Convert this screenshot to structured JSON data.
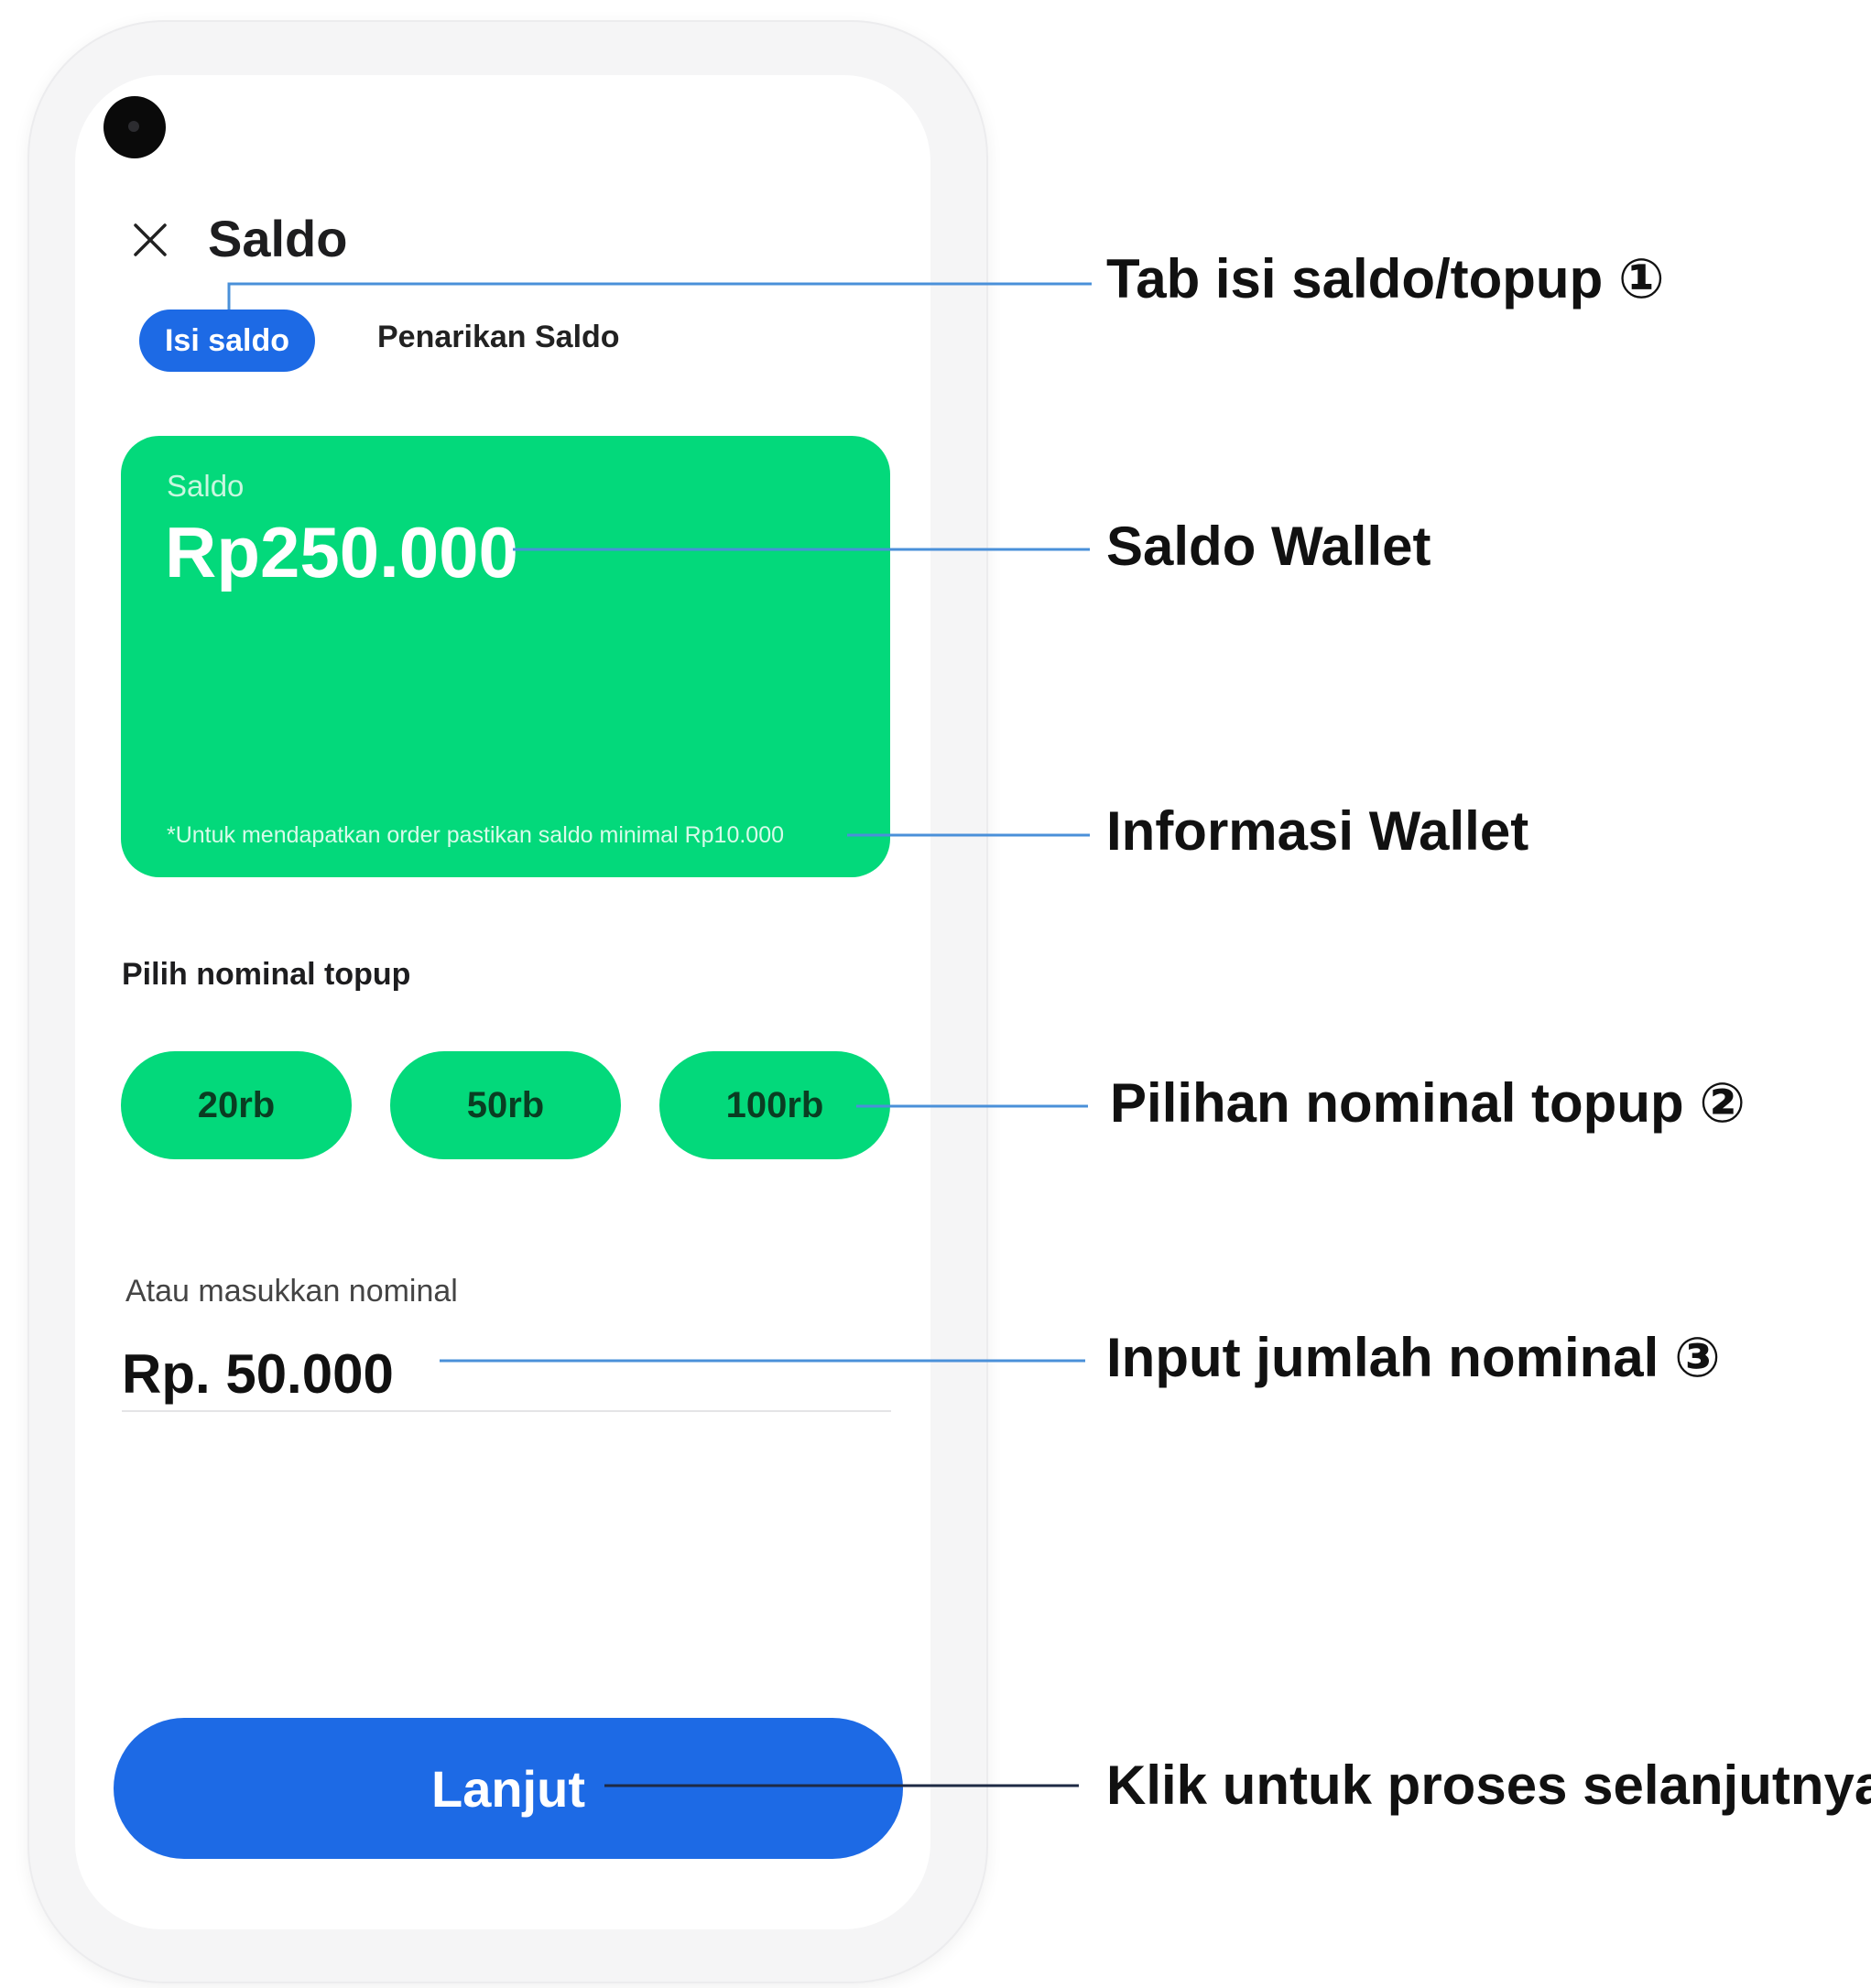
{
  "header": {
    "title": "Saldo",
    "close_icon": "close-icon"
  },
  "tabs": [
    {
      "label": "Isi saldo",
      "active": true
    },
    {
      "label": "Penarikan Saldo",
      "active": false
    }
  ],
  "wallet": {
    "label": "Saldo",
    "amount": "Rp250.000",
    "info": "*Untuk mendapatkan order pastikan saldo minimal Rp10.000"
  },
  "topup": {
    "section_label": "Pilih nominal topup",
    "options": [
      "20rb",
      "50rb",
      "100rb"
    ]
  },
  "amount_input": {
    "label": "Atau masukkan nominal",
    "value": "Rp. 50.000"
  },
  "next_button": {
    "label": "Lanjut"
  },
  "callouts": {
    "tab": "Tab isi saldo/topup ①",
    "wallet": "Saldo Wallet",
    "info": "Informasi Wallet",
    "options": "Pilihan nominal topup ②",
    "input": "Input jumlah nominal ③",
    "next": "Klik untuk proses selanjutnya"
  },
  "colors": {
    "primary_blue": "#1d6ae5",
    "wallet_green": "#03d97b",
    "callout_line": "#4a90d9"
  }
}
